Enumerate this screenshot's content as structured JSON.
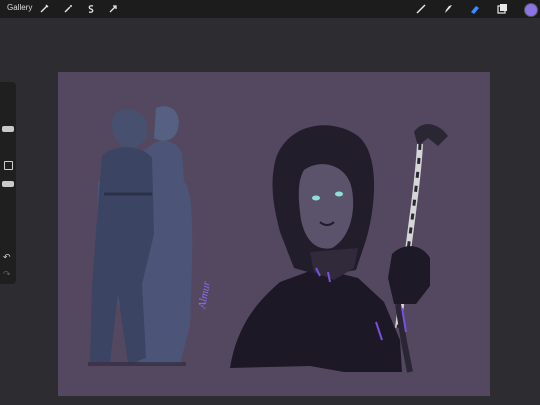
{
  "topbar": {
    "gallery_label": "Gallery",
    "left_tools": [
      {
        "name": "wrench-icon"
      },
      {
        "name": "magic-wand-icon"
      },
      {
        "name": "selection-icon"
      },
      {
        "name": "transform-icon"
      }
    ],
    "right_tools": [
      {
        "name": "brush-icon"
      },
      {
        "name": "smudge-icon"
      },
      {
        "name": "eraser-icon"
      },
      {
        "name": "layers-icon"
      }
    ],
    "active_color": "#8b73e6"
  },
  "sidebar": {
    "undo_icon": "↶",
    "redo_icon": "↷"
  },
  "canvas": {
    "background_color": "#534860",
    "signature": "Almur"
  }
}
